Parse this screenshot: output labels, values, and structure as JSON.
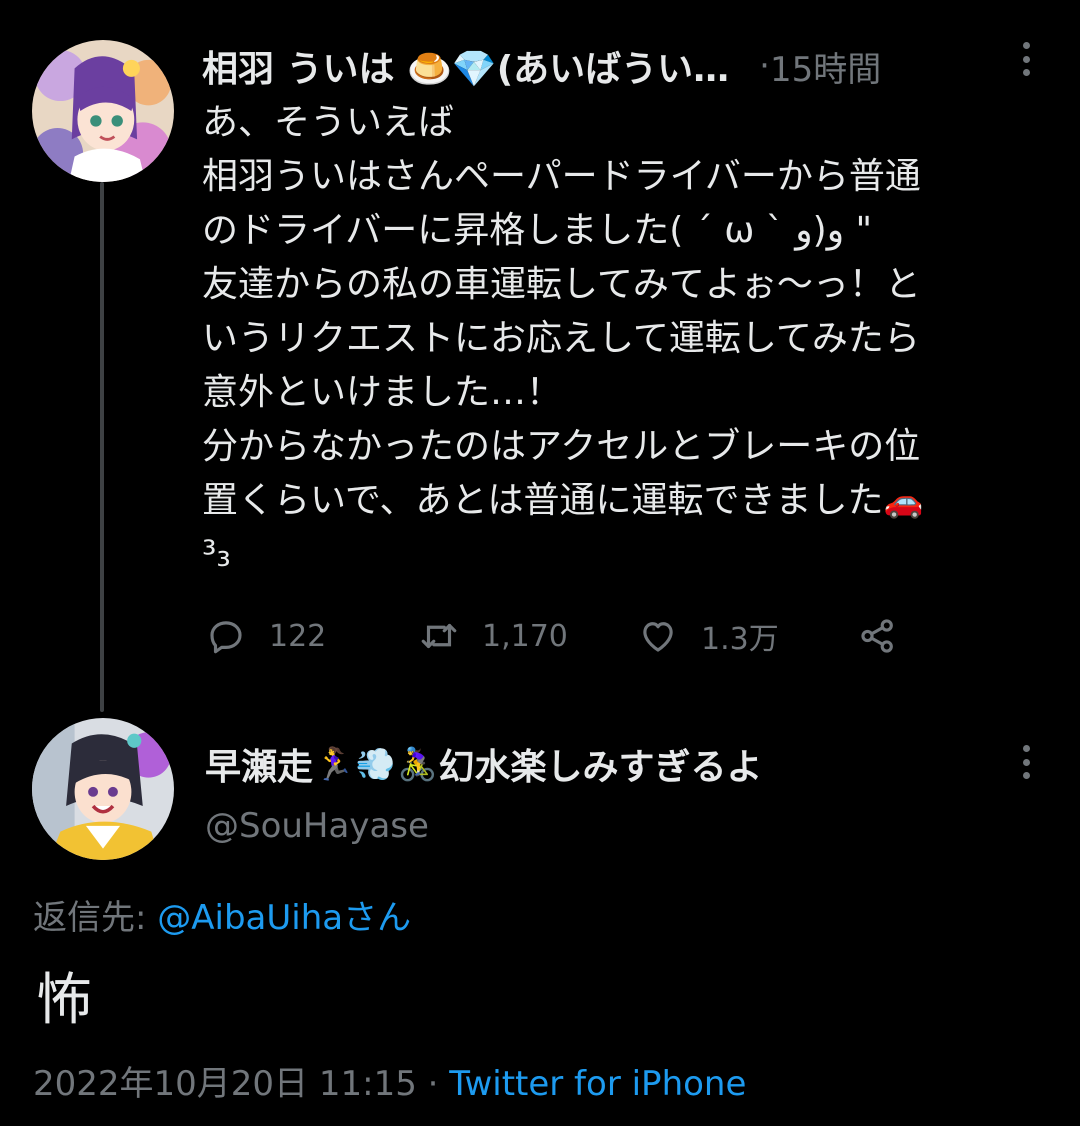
{
  "thread": {
    "parent": {
      "display_name": "相羽 ういは 🍮💎(あいばうい…",
      "time_separator": "·",
      "time": "15時間",
      "text_lines": [
        "あ、そういえば",
        "相羽ういはさんペーパードライバーから普通",
        "のドライバーに昇格しました( ˊ ω ˋ و)و \"",
        "友達からの私の車運転してみてよぉ〜っ！と",
        "いうリクエストにお応えして運転してみたら",
        "意外といけました…！",
        "分からなかったのはアクセルとブレーキの位",
        "置くらいで、あとは普通に運転できました",
        "³₃"
      ],
      "car_emoji": "🚗",
      "stats": {
        "replies": "122",
        "retweets": "1,170",
        "likes": "1.3万"
      }
    },
    "reply": {
      "display_name_start": "早瀬走",
      "emoji_runner": "🏃‍♀️",
      "emoji_dash": "💨",
      "emoji_cyclist": "🚴‍♀️",
      "display_name_end": "幻水楽しみすぎるよ",
      "handle": "@SouHayase",
      "reply_label": "返信先: ",
      "reply_target": "@AibaUihaさん",
      "text": "怖",
      "timestamp": "2022年10月20日 11:15",
      "meta_separator": " · ",
      "client": "Twitter for iPhone"
    }
  },
  "icons": {
    "reply": "reply-icon",
    "retweet": "retweet-icon",
    "like": "heart-icon",
    "share": "share-icon",
    "more": "more-vertical-icon"
  },
  "colors": {
    "background": "#000000",
    "text": "#e7e9ea",
    "muted": "#71767b",
    "link": "#1d9bf0",
    "thread_line": "#3e4144"
  }
}
